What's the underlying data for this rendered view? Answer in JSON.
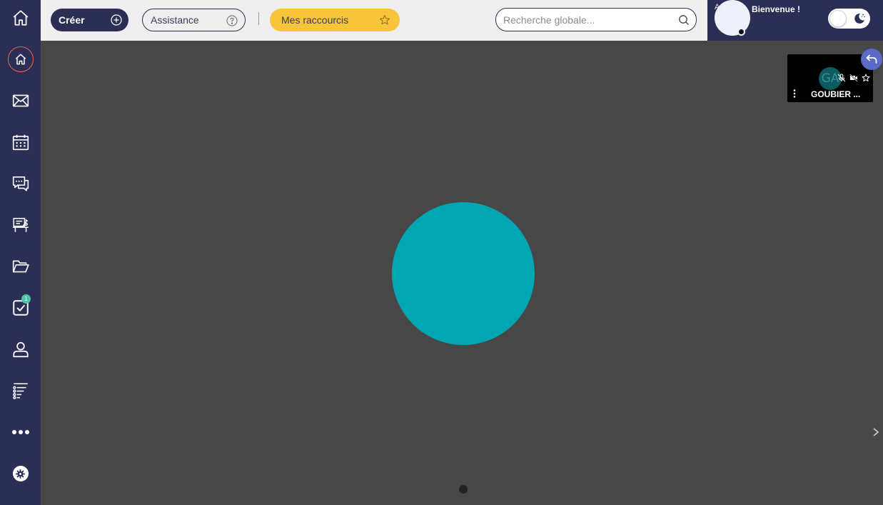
{
  "topbar": {
    "create_label": "Créer",
    "assist_label": "Assistance",
    "shortcuts_label": "Mes raccourcis",
    "search_placeholder": "Recherche globale..."
  },
  "user": {
    "welcome": "Bienvenue !",
    "avatar_text": "Ar"
  },
  "sidebar": {
    "tasks_badge": "1",
    "items": [
      "home-icon",
      "recent-icon",
      "mail-icon",
      "calendar-icon",
      "chat-icon",
      "classroom-icon",
      "folder-icon",
      "tasks-icon",
      "user-icon",
      "list-icon",
      "more-icon",
      "settings-icon"
    ]
  },
  "participant": {
    "initials": "GA",
    "name": "GOUBIER ..."
  },
  "colors": {
    "sidebar": "#2b2f55",
    "accent_orange": "#e8694a",
    "shortcuts_yellow": "#f8c53a",
    "stage_bg": "#474747",
    "speaker_circle": "#00a7b3",
    "back_button": "#5b6ac6"
  }
}
